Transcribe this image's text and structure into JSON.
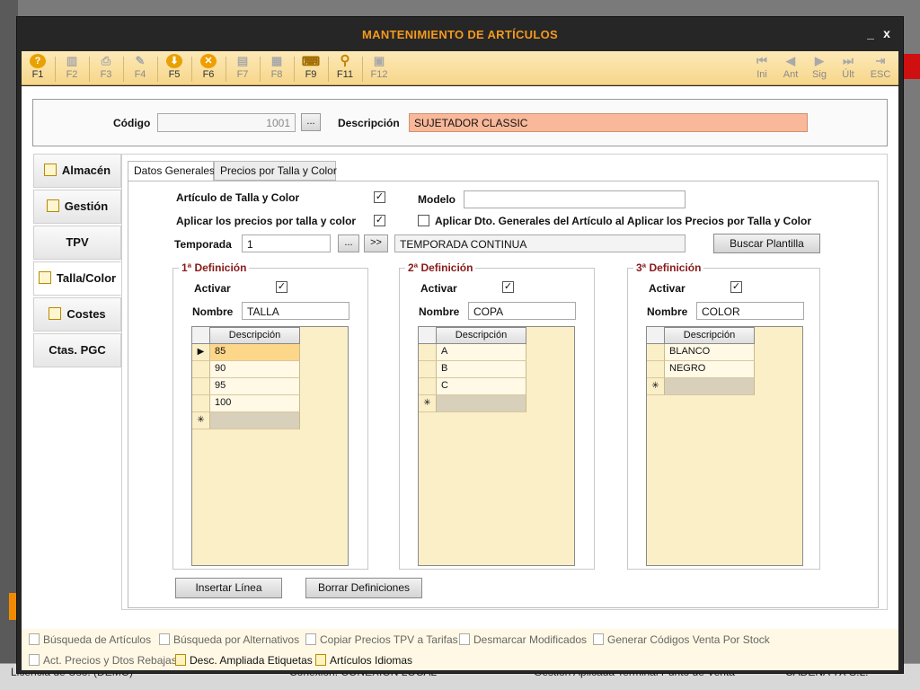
{
  "window": {
    "title": "MANTENIMIENTO DE ARTÍCULOS",
    "minimize": "_",
    "close": "x"
  },
  "toolbar": {
    "keys": [
      {
        "label": "F1",
        "icon": "?",
        "icon_name": "help-icon",
        "enabled": true
      },
      {
        "label": "F2",
        "icon": "▥",
        "icon_name": "delete-icon",
        "enabled": false
      },
      {
        "label": "F3",
        "icon": "⎙",
        "icon_name": "print-icon",
        "enabled": false
      },
      {
        "label": "F4",
        "icon": "✎",
        "icon_name": "edit-icon",
        "enabled": false
      },
      {
        "label": "F5",
        "icon": "⬇",
        "icon_name": "save-icon",
        "enabled": true
      },
      {
        "label": "F6",
        "icon": "✕",
        "icon_name": "cancel-icon",
        "enabled": true
      },
      {
        "label": "F7",
        "icon": "▤",
        "icon_name": "document-icon",
        "enabled": false
      },
      {
        "label": "F8",
        "icon": "▦",
        "icon_name": "list-icon",
        "enabled": false
      },
      {
        "label": "F9",
        "icon": "⌨",
        "icon_name": "keyboard-icon",
        "enabled": true
      },
      {
        "label": "F11",
        "icon": "⚲",
        "icon_name": "search-icon",
        "enabled": true
      },
      {
        "label": "F12",
        "icon": "▣",
        "icon_name": "copy-icon",
        "enabled": false
      }
    ],
    "nav": [
      {
        "label": "Ini",
        "icon": "⏮",
        "icon_name": "first-icon"
      },
      {
        "label": "Ant",
        "icon": "◀",
        "icon_name": "previous-icon"
      },
      {
        "label": "Sig",
        "icon": "▶",
        "icon_name": "next-icon"
      },
      {
        "label": "Últ",
        "icon": "⏭",
        "icon_name": "last-icon"
      },
      {
        "label": "ESC",
        "icon": "⇥",
        "icon_name": "exit-icon"
      }
    ]
  },
  "header": {
    "codigo_label": "Código",
    "codigo_value": "1001",
    "lookup_btn": "...",
    "descripcion_label": "Descripción",
    "descripcion_value": "SUJETADOR CLASSIC"
  },
  "side_tabs": [
    {
      "label": "Almacén",
      "icon": "document-icon"
    },
    {
      "label": "Gestión",
      "icon": "bottle-icon"
    },
    {
      "label": "TPV",
      "icon": ""
    },
    {
      "label": "Talla/Color",
      "icon": "add-document-icon",
      "selected": true
    },
    {
      "label": "Costes",
      "icon": "edit-icon"
    },
    {
      "label": "Ctas. PGC",
      "icon": ""
    }
  ],
  "tabs": [
    {
      "label": "Datos Generales",
      "selected": true
    },
    {
      "label": "Precios por Talla y Color"
    }
  ],
  "form": {
    "talla_color_label": "Artículo de Talla y Color",
    "talla_color_checked": "✓",
    "aplicar_precios_label": "Aplicar los precios por talla y color",
    "aplicar_precios_checked": "✓",
    "modelo_label": "Modelo",
    "modelo_value": "",
    "aplicar_dto_label": "Aplicar Dto. Generales del Artículo al Aplicar los Precios por Talla y Color",
    "aplicar_dto_checked": "",
    "temporada_label": "Temporada",
    "temporada_value": "1",
    "temporada_btn1": "...",
    "temporada_btn2": ">>",
    "temporada_desc": "TEMPORADA CONTINUA",
    "buscar_plantilla": "Buscar Plantilla"
  },
  "definitions": [
    {
      "title": "1ª Definición",
      "activar_label": "Activar",
      "activar": "✓",
      "nombre_label": "Nombre",
      "nombre": "TALLA",
      "column": "Descripción",
      "rows": [
        "85",
        "90",
        "95",
        "100"
      ]
    },
    {
      "title": "2ª Definición",
      "activar_label": "Activar",
      "activar": "✓",
      "nombre_label": "Nombre",
      "nombre": "COPA",
      "column": "Descripción",
      "rows": [
        "A",
        "B",
        "C"
      ]
    },
    {
      "title": "3ª Definición",
      "activar_label": "Activar",
      "activar": "✓",
      "nombre_label": "Nombre",
      "nombre": "COLOR",
      "column": "Descripción",
      "rows": [
        "BLANCO",
        "NEGRO"
      ]
    }
  ],
  "grid_markers": {
    "current": "▶",
    "new": "✳"
  },
  "actions": {
    "insertar": "Insertar Línea",
    "borrar": "Borrar Definiciones"
  },
  "bottom_links": [
    {
      "label": "Búsqueda de Artículos",
      "enabled": false
    },
    {
      "label": "Búsqueda por Alternativos",
      "enabled": false
    },
    {
      "label": "Copiar Precios TPV a Tarifas",
      "enabled": false
    },
    {
      "label": "Desmarcar Modificados",
      "enabled": false
    },
    {
      "label": "Generar Códigos Venta Por Stock",
      "enabled": false
    },
    {
      "label": "Act. Precios y Dtos Rebajas",
      "enabled": false
    },
    {
      "label": "Desc. Ampliada Etiquetas",
      "enabled": true
    },
    {
      "label": "Artículos Idiomas",
      "enabled": true
    }
  ],
  "background_status": [
    "Licencia de Uso: (DEMO)",
    "Conexión: CONEXION LOCAL",
    "Gestión Aplicada Terminal Punto de Venta",
    "CADENA TX S.L."
  ]
}
